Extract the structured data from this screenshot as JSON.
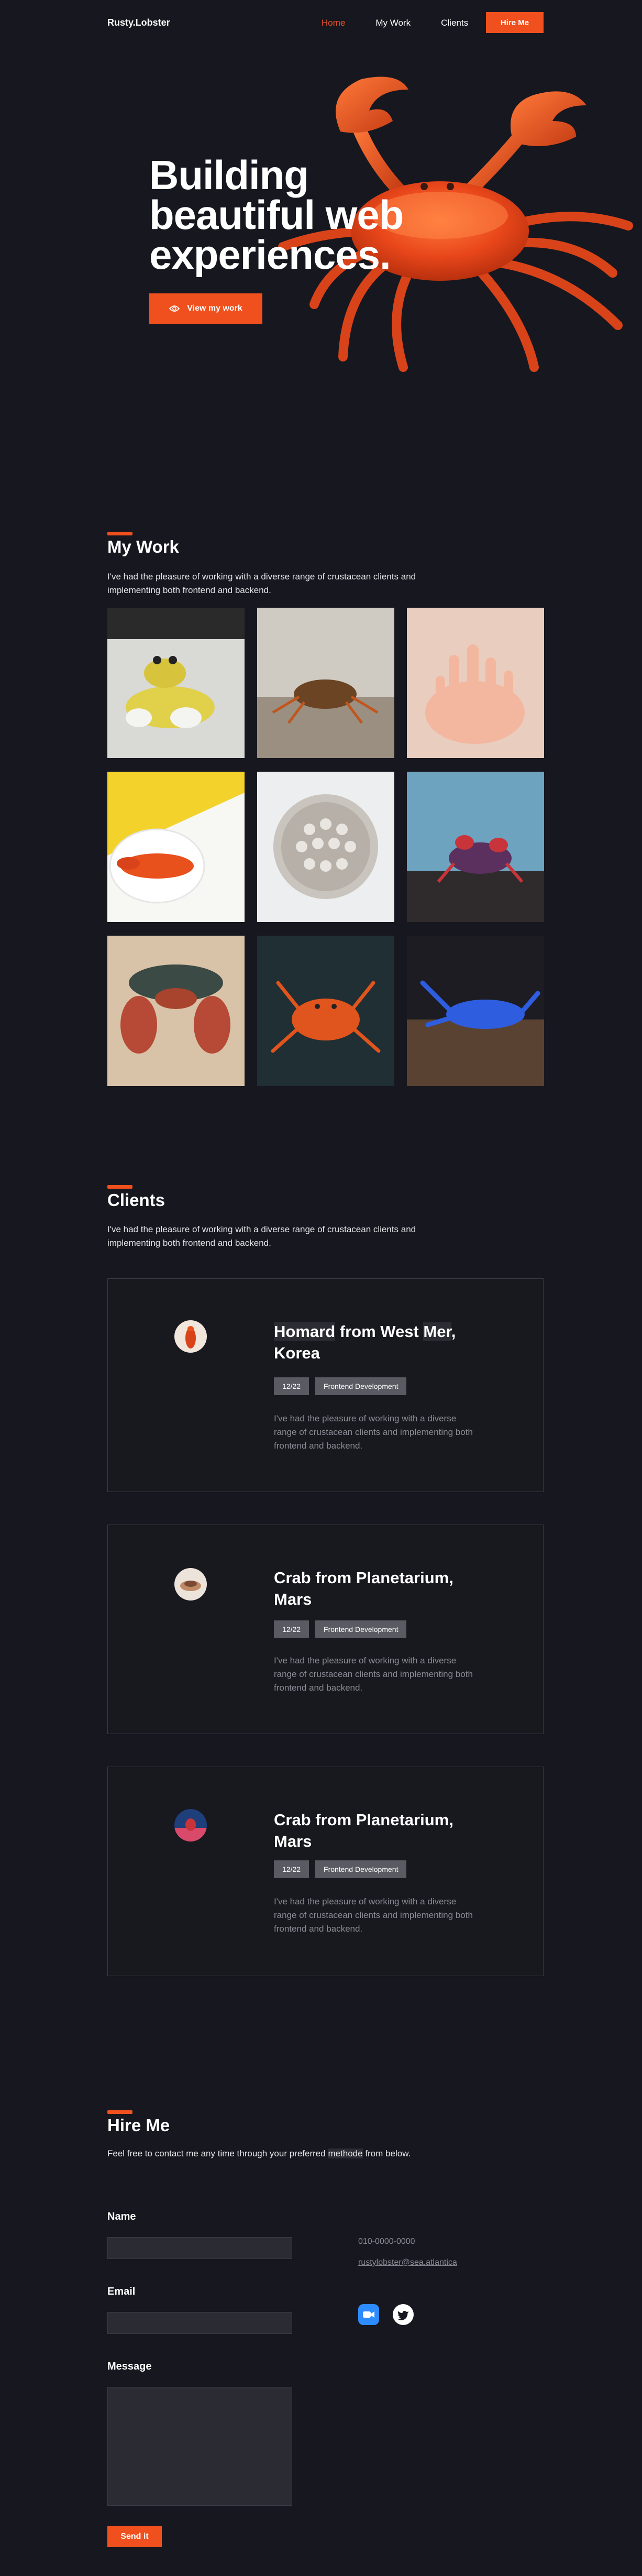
{
  "nav": {
    "brand": "Rusty.Lobster",
    "links": [
      "Home",
      "My Work",
      "Clients"
    ],
    "hire_label": "Hire Me"
  },
  "hero": {
    "title_lines": [
      "Building",
      "beautiful web",
      "experiences."
    ],
    "cta_label": "View my work",
    "cta_icon": "eye-icon"
  },
  "work": {
    "title": "My Work",
    "description": "I've had the pleasure of working with a diverse range of crustacean clients and implementing both frontend and backend."
  },
  "clients": {
    "title": "Clients",
    "description": "I've had the pleasure of working with a diverse range of crustacean clients and implementing both frontend and backend.",
    "cards": [
      {
        "title_parts": [
          "Homard",
          " from West ",
          "Mer",
          ",",
          "Korea"
        ],
        "tag_date": "12/22",
        "tag_role": "Frontend Development",
        "text": "I've had the pleasure of working with a diverse range of crustacean clients and implementing both frontend and backend."
      },
      {
        "title_line1": "Crab from Planetarium,",
        "title_line2": "Mars",
        "tag_date": "12/22",
        "tag_role": "Frontend Development",
        "text": "I've had the pleasure of working with a diverse range of crustacean clients and implementing both frontend and backend."
      },
      {
        "title_line1": "Crab from Planetarium,",
        "title_line2": "Mars",
        "tag_date": "12/22",
        "tag_role": "Frontend Development",
        "text": "I've had the pleasure of working with a diverse range of crustacean clients and implementing both frontend and backend."
      }
    ]
  },
  "hire": {
    "title": "Hire Me",
    "description_before": "Feel free to contact me any time through your preferred ",
    "description_highlight": "methode",
    "description_after": " from below.",
    "name_label": "Name",
    "email_label": "Email",
    "message_label": "Message",
    "phone": "010-0000-0000",
    "email": "rustylobster@sea.atlantica",
    "send_label": "Send it",
    "social_icons": [
      "zoom-icon",
      "twitter-icon"
    ]
  },
  "colors": {
    "background": "#17171f",
    "accent": "#f0501e",
    "tag": "#5a5a62"
  }
}
